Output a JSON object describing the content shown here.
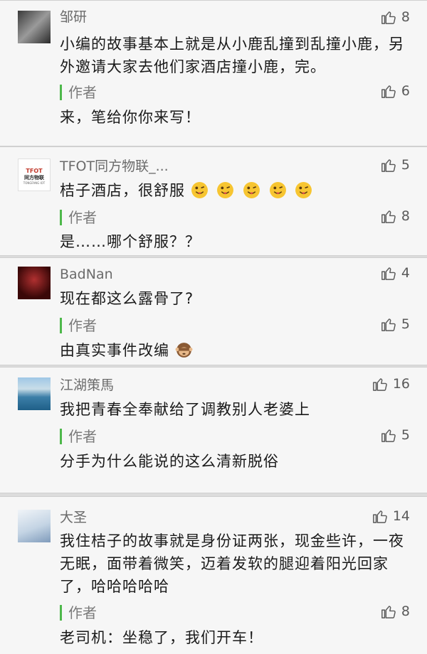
{
  "author_label": "作者",
  "comments": [
    {
      "user": "邹研",
      "likes": "8",
      "text": "小编的故事基本上就是从小鹿乱撞到乱撞小鹿，另外邀请大家去他们家酒店撞小鹿，完。",
      "reply": "来，笔给你你来写！",
      "reply_likes": "6",
      "avatar": "warrior-avatar"
    },
    {
      "user": "TFOT同方物联_...",
      "likes": "5",
      "text": "桔子酒店，很舒服",
      "emoji": [
        "tongue-wink-emoji",
        "tongue-wink-emoji",
        "tongue-wink-emoji",
        "tongue-wink-emoji",
        "tongue-wink-emoji"
      ],
      "reply": "是……哪个舒服？？",
      "reply_likes": "8",
      "avatar": "tfot-logo-avatar",
      "avatar_text_1": "TFOT",
      "avatar_text_2": "同方物联",
      "avatar_text_3": "TONGFANG IOT"
    },
    {
      "user": "BadNan",
      "likes": "4",
      "text": "现在都这么露骨了?",
      "reply": "由真实事件改编",
      "reply_emoji": "see-no-evil-monkey-emoji",
      "reply_likes": "5",
      "avatar": "dark-red-avatar"
    },
    {
      "user": "江湖策馬",
      "likes": "16",
      "text": "我把青春全奉献给了调教别人老婆上",
      "reply": "分手为什么能说的这么清新脱俗",
      "reply_likes": "5",
      "avatar": "sea-avatar"
    },
    {
      "user": "大圣",
      "likes": "14",
      "text": "我住桔子的故事就是身份证两张，现金些许，一夜无眠，面带着微笑，迈着发软的腿迎着阳光回家了，哈哈哈哈哈",
      "reply": "老司机：坐稳了，我们开车！",
      "reply_likes": "8",
      "avatar": "sketch-avatar"
    }
  ],
  "colors": {
    "author_bar": "#4eb84b",
    "like_icon": "#5a5a5a"
  }
}
